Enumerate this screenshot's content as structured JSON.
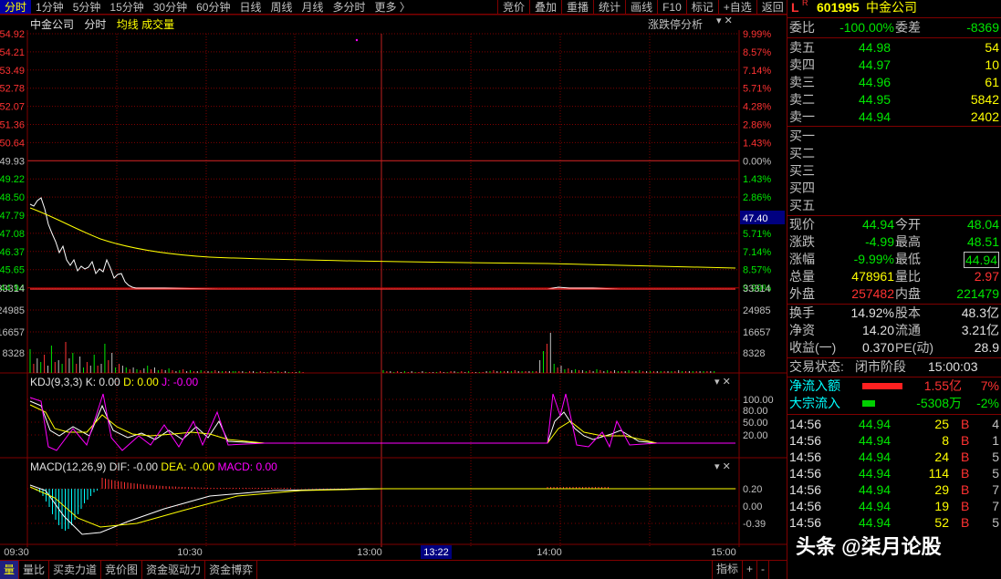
{
  "toolbar": {
    "tabs": [
      "分时",
      "1分钟",
      "5分钟",
      "15分钟",
      "30分钟",
      "60分钟",
      "日线",
      "周线",
      "月线",
      "多分时",
      "更多 〉"
    ],
    "right": [
      "竞价",
      "叠加",
      "重播",
      "统计",
      "画线",
      "F10",
      "标记",
      "+自选",
      "返回"
    ]
  },
  "chart_header": {
    "name": "中金公司",
    "mode": "分时",
    "avg_line": "均线",
    "volume": "成交量",
    "limit_analysis": "涨跌停分析"
  },
  "price_axis_left": [
    "54.92",
    "54.21",
    "53.49",
    "52.78",
    "52.07",
    "51.36",
    "50.64",
    "49.93",
    "49.22",
    "48.50",
    "47.79",
    "47.08",
    "46.37",
    "45.65",
    "44.94"
  ],
  "pct_axis_right": [
    "9.99%",
    "8.57%",
    "7.14%",
    "5.71%",
    "4.28%",
    "2.86%",
    "1.43%",
    "0.00%",
    "1.43%",
    "2.86%",
    "4.28%",
    "5.71%",
    "7.14%",
    "8.57%",
    "9.99%"
  ],
  "cursor_price": "47.40",
  "volume_axis": [
    "33314",
    "24985",
    "16657",
    "8328"
  ],
  "kdj": {
    "title": "KDJ(9,3,3)",
    "k": "K: 0.00",
    "d": "D: 0.00",
    "j": "J: -0.00",
    "axis": [
      "100.00",
      "80.00",
      "50.00",
      "20.00"
    ]
  },
  "macd": {
    "title": "MACD(12,26,9)",
    "dif": "DIF: -0.00",
    "dea": "DEA: -0.00",
    "macd": "MACD: 0.00",
    "axis": [
      "0.20",
      "0.00",
      "-0.39"
    ]
  },
  "time_axis": [
    "09:30",
    "10:30",
    "13:00",
    "13:22",
    "14:00",
    "15:00"
  ],
  "bottom_tabs": [
    "量",
    "量比",
    "买卖力道",
    "竞价图",
    "资金驱动力",
    "资金博弈"
  ],
  "bottom_right": [
    "指标",
    "+",
    "-"
  ],
  "quote": {
    "flag": "L",
    "flag_sup": "R",
    "code": "601995",
    "name": "中金公司",
    "webi_label": "委比",
    "webi": "-100.00%",
    "weicha_label": "委差",
    "weicha": "-8369",
    "asks": [
      {
        "label": "卖五",
        "price": "44.98",
        "vol": "54"
      },
      {
        "label": "卖四",
        "price": "44.97",
        "vol": "10"
      },
      {
        "label": "卖三",
        "price": "44.96",
        "vol": "61"
      },
      {
        "label": "卖二",
        "price": "44.95",
        "vol": "5842"
      },
      {
        "label": "卖一",
        "price": "44.94",
        "vol": "2402"
      }
    ],
    "bids": [
      {
        "label": "买一"
      },
      {
        "label": "买二"
      },
      {
        "label": "买三"
      },
      {
        "label": "买四"
      },
      {
        "label": "买五"
      }
    ],
    "stats": [
      {
        "l1": "现价",
        "v1": "44.94",
        "l2": "今开",
        "v2": "48.04",
        "c1": "green",
        "c2": "green"
      },
      {
        "l1": "涨跌",
        "v1": "-4.99",
        "l2": "最高",
        "v2": "48.51",
        "c1": "green",
        "c2": "green"
      },
      {
        "l1": "涨幅",
        "v1": "-9.99%",
        "l2": "最低",
        "v2": "44.94",
        "c1": "green",
        "c2": "green"
      },
      {
        "l1": "总量",
        "v1": "478961",
        "l2": "量比",
        "v2": "2.97",
        "c1": "yellow",
        "c2": "red"
      },
      {
        "l1": "外盘",
        "v1": "257482",
        "l2": "内盘",
        "v2": "221479",
        "c1": "red",
        "c2": "green"
      }
    ],
    "stats2": [
      {
        "l1": "换手",
        "v1": "14.92%",
        "l2": "股本",
        "v2": "48.3亿"
      },
      {
        "l1": "净资",
        "v1": "14.20",
        "l2": "流通",
        "v2": "3.21亿"
      },
      {
        "l1": "收益(一)",
        "v1": "0.370",
        "l2": "PE(动)",
        "v2": "28.9"
      }
    ],
    "trade_status_label": "交易状态:",
    "trade_status": "闭市阶段",
    "trade_time": "15:00:03",
    "net_inflow_label": "净流入额",
    "net_inflow": "1.55亿",
    "net_inflow_pct": "7%",
    "block_inflow_label": "大宗流入",
    "block_inflow": "-5308万",
    "block_inflow_pct": "-2%",
    "ticks": [
      {
        "t": "14:56",
        "p": "44.94",
        "v": "25",
        "bs": "B",
        "n": "4"
      },
      {
        "t": "14:56",
        "p": "44.94",
        "v": "8",
        "bs": "B",
        "n": "1"
      },
      {
        "t": "14:56",
        "p": "44.94",
        "v": "24",
        "bs": "B",
        "n": "5"
      },
      {
        "t": "14:56",
        "p": "44.94",
        "v": "114",
        "bs": "B",
        "n": "5"
      },
      {
        "t": "14:56",
        "p": "44.94",
        "v": "29",
        "bs": "B",
        "n": "7"
      },
      {
        "t": "14:56",
        "p": "44.94",
        "v": "19",
        "bs": "B",
        "n": "7"
      },
      {
        "t": "14:56",
        "p": "44.94",
        "v": "52",
        "bs": "B",
        "n": "5"
      }
    ]
  },
  "watermark": "头条 @柒月论股",
  "colors": {
    "background": "#000000",
    "grid_red": "#800000",
    "price_line": "#ffffff",
    "avg_line": "#ffff00",
    "up": "#ff3232",
    "down": "#00e600",
    "kdj_j": "#ff00ff"
  }
}
